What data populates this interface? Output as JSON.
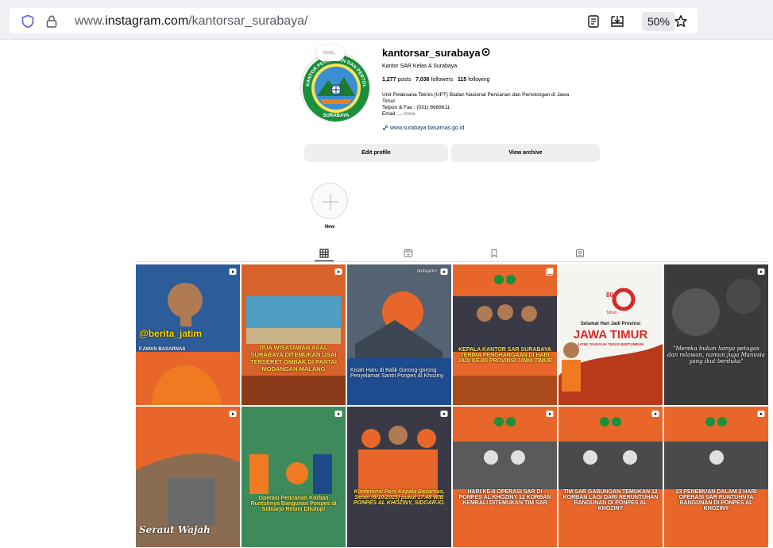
{
  "browser": {
    "url_prefix": "www.",
    "url_domain": "instagram.com",
    "url_path": "/kantorsar_surabaya/",
    "zoom": "50%",
    "icons": [
      "shield-icon",
      "lock-icon",
      "reader-view-icon",
      "save-to-pocket-icon",
      "bookmark-star-icon"
    ]
  },
  "profile": {
    "note": "Note...",
    "username": "kantorsar_surabaya",
    "fullname": "Kantor SAR Kelas A Surabaya",
    "posts": "1,277",
    "posts_label": "posts",
    "followers": "7,036",
    "followers_label": "followers",
    "following": "115",
    "following_label": "following",
    "bio_line1": "Unit Pelaksana Teknis (UPT) Badan Nasional Pencarian dan Pertolongan di Jawa",
    "bio_line2": "Timur",
    "bio_line3": "Telpon & Fax : (031) 8669611",
    "bio_line4": "Email :...",
    "more": "more",
    "link": "www.surabaya.basarnas.go.id",
    "logo_ring_text": "KANTOR PENCARIAN DAN PERTOLONGAN",
    "logo_bottom_text": "SURABAYA"
  },
  "buttons": {
    "edit_profile": "Edit profile",
    "view_archive": "View archive"
  },
  "highlights": {
    "new_label": "New"
  },
  "tabs": [
    "posts",
    "reels",
    "saved",
    "tagged"
  ],
  "posts": [
    {
      "caption": "",
      "overlay": "@berita_jatim",
      "names": "F.AWAN   BASARNAS"
    },
    {
      "caption": "DUA WISATAWAN ASAL SURABAYA DITEMUKAN USAI TERSERET OMBAK DI PANTAI MODANGAN MALANG"
    },
    {
      "caption": "Kisah Haru di Balik Gorong-gorong Penyelamat Santri Ponpes Al Khoziny",
      "source": "detikjatim"
    },
    {
      "caption": "KEPALA KANTOR SAR SURABAYA TERIMA PENGHARGAAN DI HARI JADI KE-80 PROVINSI JAWA TIMUR"
    },
    {
      "caption": "Selamat Hari Jadi Provinsi",
      "title": "JAWA TIMUR",
      "sub": "JATIM TANGGUH TERUS BERTUMBUH",
      "badge": "80",
      "badge_sub": "Tahun"
    },
    {
      "caption": "\"Mereka bukan hanya petugas dan relawan, namun juga Manusia yang ikut berduka\""
    },
    {
      "caption": "Seraut Wajah"
    },
    {
      "caption": "Operasi Pencarian Korban Runtuhnya Bangunan Ponpes di Sidoarjo Resmi Ditutup!"
    },
    {
      "caption": "Konferensi Pers Kepala Basarnas, Senin (6/10/2025) pukul 17.48 WIB PONPES AL KHOZINY, SIDOARJO."
    },
    {
      "caption": "HARI KE-8 OPERASI SAR DI PONPES AL KHOZINY 12 KORBAN KEMBALI DITEMUKAN TIM SAR"
    },
    {
      "caption": "TIM SAR GABUNGAN TEMUKAN 12 KORBAN LAGI DARI RERUNTUHAN BANGUNAN DI PONPES AL KHOZINY"
    },
    {
      "caption": "23 PENEMUAN DALAM 2 HARI OPERASI SAR RUNTUHNYA BANGUNAN DI PONPES AL KHOZINY"
    }
  ],
  "colors": {
    "sar_orange": "#e8662a",
    "link_blue": "#00376b",
    "button_gray": "#efefef"
  }
}
